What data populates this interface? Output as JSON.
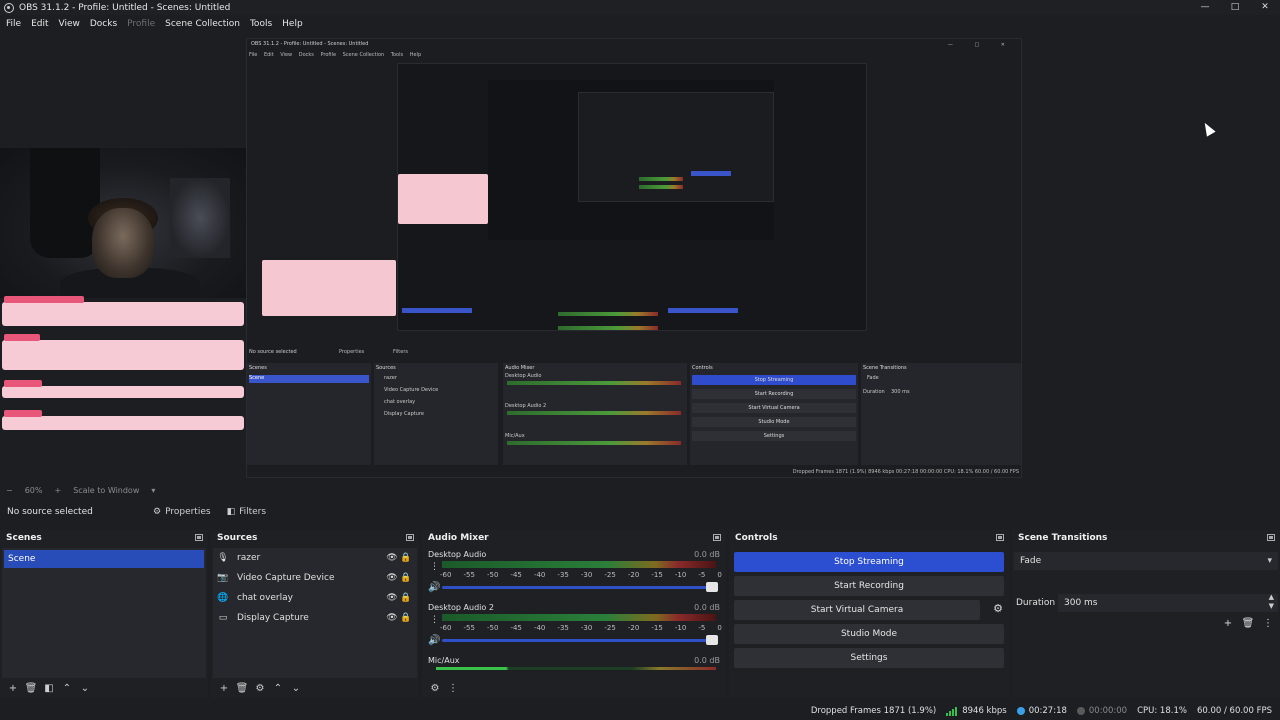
{
  "window": {
    "title": "OBS 31.1.2 - Profile: Untitled - Scenes: Untitled",
    "controls": [
      "—",
      "□",
      "✕"
    ]
  },
  "menu": [
    "File",
    "Edit",
    "View",
    "Docks",
    "Profile",
    "Scene Collection",
    "Tools",
    "Help"
  ],
  "preview": {
    "nested_title": "OBS 31.1.2 - Profile: Untitled - Scenes: Untitled",
    "nested_menu": [
      "File",
      "Edit",
      "View",
      "Docks",
      "Profile",
      "Scene Collection",
      "Tools",
      "Help"
    ],
    "nested_no_source": "No source selected",
    "nested_properties": "Properties",
    "nested_filters": "Filters",
    "nested_docks": {
      "scenes": "Scenes",
      "scene_item": "Scene",
      "sources": "Sources",
      "source_items": [
        "razer",
        "Video Capture Device",
        "chat overlay",
        "Display Capture"
      ],
      "mixer": "Audio Mixer",
      "mixer_channels": [
        "Desktop Audio",
        "Desktop Audio 2",
        "Mic/Aux"
      ],
      "controls": "Controls",
      "control_buttons": [
        "Stop Streaming",
        "Start Recording",
        "Start Virtual Camera",
        "Studio Mode",
        "Settings"
      ],
      "transitions": "Scene Transitions",
      "transition_value": "Fade",
      "duration_label": "Duration",
      "duration_value": "300 ms"
    },
    "nested_status": "Dropped Frames 1871 (1.9%)   8946 kbps   00:27:18   00:00:00   CPU: 18.1%   60.00 / 60.00 FPS"
  },
  "zoom": {
    "level": "60%",
    "fit": "Scale to Window"
  },
  "source_toolbar": {
    "no_source": "No source selected",
    "properties": "Properties",
    "filters": "Filters"
  },
  "scenes": {
    "title": "Scenes",
    "items": [
      "Scene"
    ]
  },
  "sources": {
    "title": "Sources",
    "items": [
      {
        "label": "razer",
        "icon": "microphone-icon"
      },
      {
        "label": "Video Capture Device",
        "icon": "camera-icon"
      },
      {
        "label": "chat overlay",
        "icon": "globe-icon"
      },
      {
        "label": "Display Capture",
        "icon": "monitor-icon"
      }
    ]
  },
  "mixer": {
    "title": "Audio Mixer",
    "ticks": [
      "-60",
      "-55",
      "-50",
      "-45",
      "-40",
      "-35",
      "-30",
      "-25",
      "-20",
      "-15",
      "-10",
      "-5",
      "0"
    ],
    "channels": [
      {
        "name": "Desktop Audio",
        "db": "0.0 dB",
        "volume": 0.97
      },
      {
        "name": "Desktop Audio 2",
        "db": "0.0 dB",
        "volume": 0.97
      },
      {
        "name": "Mic/Aux",
        "db": "0.0 dB",
        "volume": 0.97
      }
    ]
  },
  "controls": {
    "title": "Controls",
    "stop_streaming": "Stop Streaming",
    "start_recording": "Start Recording",
    "start_virtual_camera": "Start Virtual Camera",
    "studio_mode": "Studio Mode",
    "settings": "Settings"
  },
  "transitions": {
    "title": "Scene Transitions",
    "selected": "Fade",
    "duration_label": "Duration",
    "duration_value": "300 ms"
  },
  "status": {
    "dropped_frames": "Dropped Frames 1871 (1.9%)",
    "bitrate": "8946 kbps",
    "stream_time": "00:27:18",
    "record_time": "00:00:00",
    "cpu": "CPU: 18.1%",
    "fps": "60.00 / 60.00 FPS"
  },
  "colors": {
    "accent": "#2c4fd2",
    "selection": "#284cb8",
    "background": "#1d1e22",
    "dock": "#1f2024"
  }
}
